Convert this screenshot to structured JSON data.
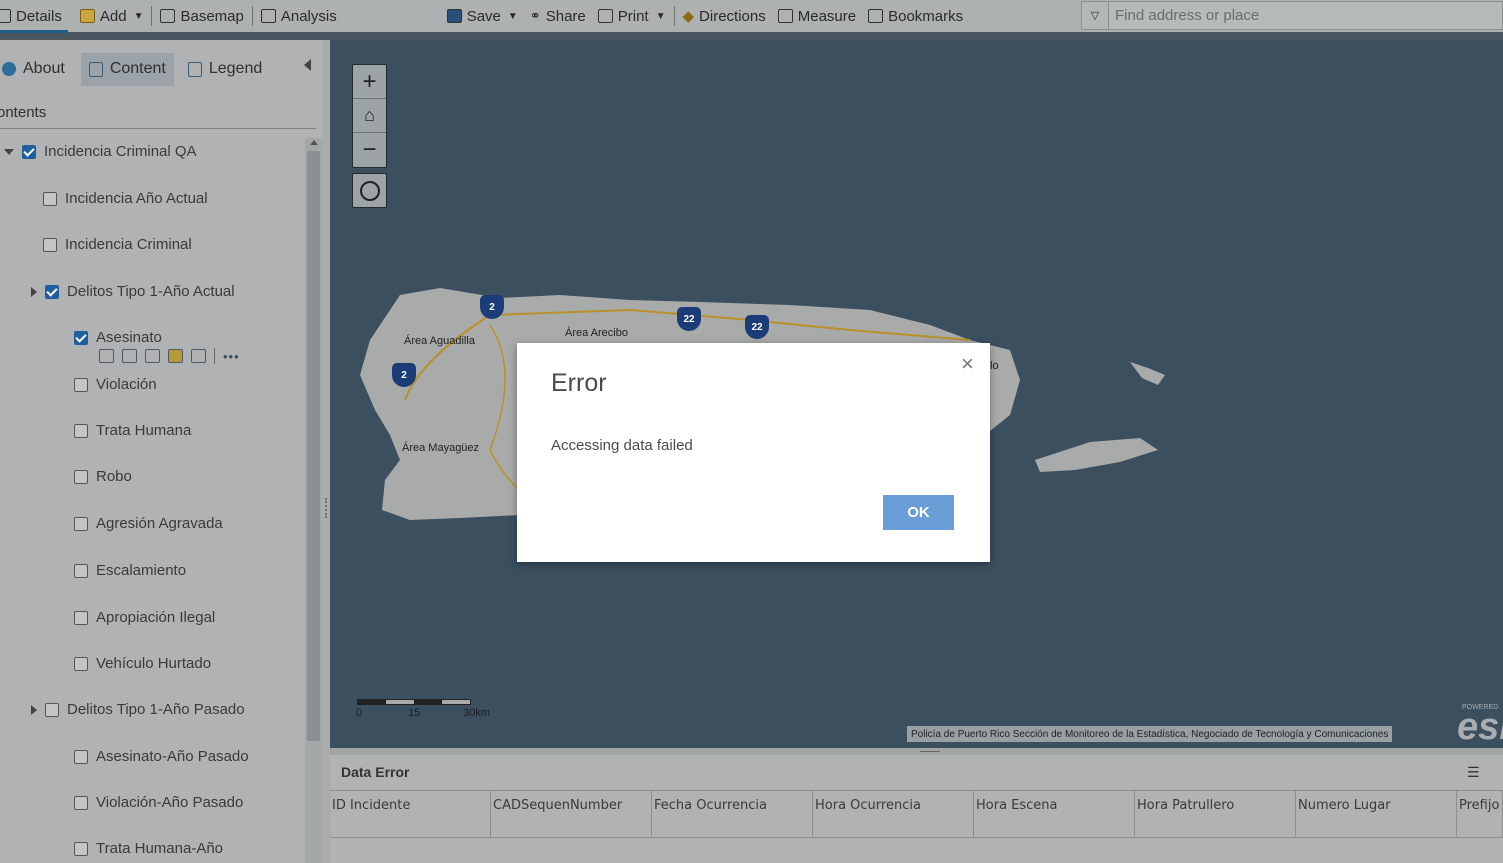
{
  "toolbar": {
    "details": "Details",
    "add": "Add",
    "basemap": "Basemap",
    "analysis": "Analysis",
    "save": "Save",
    "share": "Share",
    "print": "Print",
    "directions": "Directions",
    "measure": "Measure",
    "bookmarks": "Bookmarks",
    "search_placeholder": "Find address or place"
  },
  "panel": {
    "tabs": {
      "about": "About",
      "content": "Content",
      "legend": "Legend"
    },
    "contents_title": "ontents",
    "layers": [
      {
        "label": "Incidencia Criminal QA",
        "checked": true
      },
      {
        "label": "Incidencia Año Actual",
        "checked": false
      },
      {
        "label": "Incidencia Criminal",
        "checked": false
      },
      {
        "label": "Delitos Tipo 1-Año Actual",
        "checked": true
      },
      {
        "label": "Asesinato",
        "checked": true
      },
      {
        "label": "Violación",
        "checked": false
      },
      {
        "label": "Trata Humana",
        "checked": false
      },
      {
        "label": "Robo",
        "checked": false
      },
      {
        "label": "Agresión Agravada",
        "checked": false
      },
      {
        "label": "Escalamiento",
        "checked": false
      },
      {
        "label": "Apropiación Ilegal",
        "checked": false
      },
      {
        "label": "Vehículo Hurtado",
        "checked": false
      },
      {
        "label": "Delitos Tipo 1-Año Pasado",
        "checked": false
      },
      {
        "label": "Asesinato-Año Pasado",
        "checked": false
      },
      {
        "label": "Violación-Año Pasado",
        "checked": false
      },
      {
        "label": "Trata Humana-Año",
        "checked": false
      }
    ]
  },
  "map": {
    "labels": {
      "aguadilla": "Área Aguadilla",
      "arecibo": "Área Arecibo",
      "mayaguez": "Área Mayagüez",
      "partial": "lo"
    },
    "shields": [
      "2",
      "22",
      "22",
      "2"
    ],
    "scale": {
      "s0": "0",
      "s1": "15",
      "s2": "30km"
    },
    "attribution": "Policía de Puerto Rico Sección de Monitoreo de la Estadística, Negociado de Tecnología y Comunicaciones",
    "esri_powered": "POWERED",
    "esri": "esri"
  },
  "table": {
    "title": "Data Error",
    "columns": [
      "ID Incidente",
      "CADSequenNumber",
      "Fecha Ocurrencia",
      "Hora Ocurrencia",
      "Hora Escena",
      "Hora Patrullero",
      "Numero Lugar",
      "Prefijo"
    ]
  },
  "dialog": {
    "title": "Error",
    "message": "Accessing data failed",
    "ok": "OK",
    "close": "×"
  }
}
